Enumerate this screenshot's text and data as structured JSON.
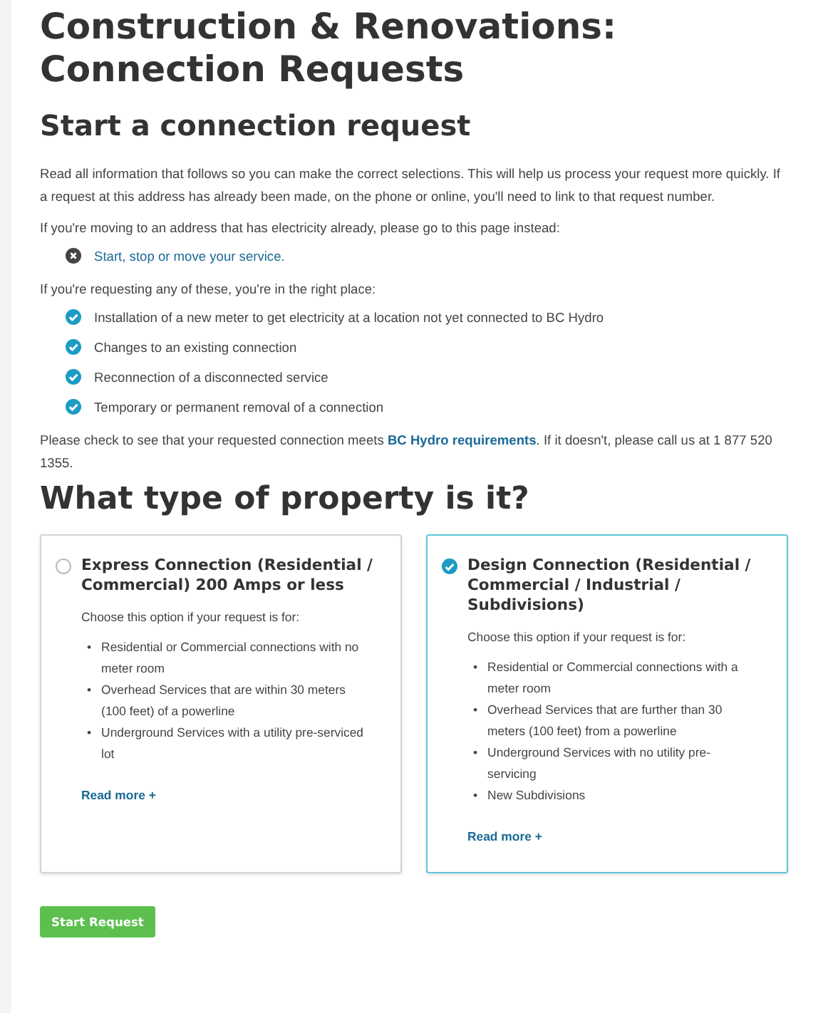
{
  "page_title": "Construction & Renovations: Connection Requests",
  "section_title": "Start a connection request",
  "intro": "Read all information that follows so you can make the correct selections. This will help us process your request more quickly. If a request at this address has already been made, on the phone or online, you'll need to link to that request number.",
  "moving_note": "If you're moving to an address that has electricity already, please go to this page instead:",
  "moving_links": [
    {
      "kind": "exclude",
      "text": "Start, stop or move your service."
    }
  ],
  "right_place_note": "If you're requesting any of these, you're in the right place:",
  "included_items": [
    {
      "kind": "include",
      "text": "Installation of a new meter to get electricity at a location not yet connected to BC Hydro"
    },
    {
      "kind": "include",
      "text": "Changes to an existing connection"
    },
    {
      "kind": "include",
      "text": "Reconnection of a disconnected service"
    },
    {
      "kind": "include",
      "text": "Temporary or permanent removal of a connection"
    }
  ],
  "requirements_note": {
    "before": "Please check to see that your requested connection meets ",
    "link": "BC Hydro requirements",
    "after": ". If it doesn't, please call us at 1 877 520 1355."
  },
  "property_question": "What type of property is it?",
  "options": [
    {
      "title": "Express Connection (Residential / Commercial) 200 Amps or less",
      "selected": false,
      "intro": "Choose this option if your request is for:",
      "bullets": [
        {
          "marker": "•",
          "text": "Residential or Commercial connections with no meter room"
        },
        {
          "marker": "•",
          "text": "Overhead Services that are within 30 meters (100 feet) of a powerline"
        },
        {
          "marker": "•",
          "text": "Underground Services with a utility pre-serviced lot"
        }
      ],
      "read_more": "Read more +"
    },
    {
      "title": "Design Connection (Residential / Commercial / Industrial / Subdivisions)",
      "selected": true,
      "intro": "Choose this option if your request is for:",
      "bullets": [
        {
          "marker": "•",
          "text": "Residential or Commercial connections with a meter room"
        },
        {
          "marker": "•",
          "text": "Overhead Services that are further than 30 meters (100 feet) from a powerline"
        },
        {
          "marker": "•",
          "text": "Underground Services with no utility pre-servicing"
        },
        {
          "marker": "•",
          "text": "New Subdivisions"
        }
      ],
      "read_more": "Read more +"
    }
  ],
  "start_button": "Start Request"
}
